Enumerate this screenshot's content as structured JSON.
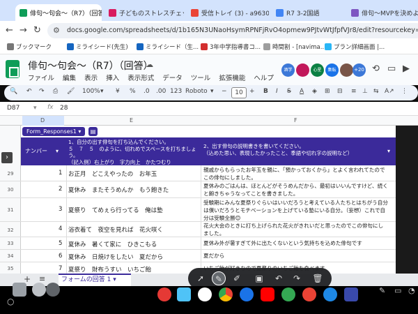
{
  "tabs": [
    {
      "label": "俳句〜句会〜（R7）（回答",
      "active": true
    },
    {
      "label": "子どものストレスチェック"
    },
    {
      "label": "受信トレイ (3) - a963091"
    },
    {
      "label": "R7 3-2国語"
    },
    {
      "label": "俳句〜MVPを決めよう"
    }
  ],
  "address": {
    "url": "docs.google.com/spreadsheets/d/1b165N3UNaoHsymRPNFjRvO4opmew9PJtvWtJfpfVJr8/edit?resourcekey=&gid=130295"
  },
  "bookmarks": [
    {
      "label": "ブックマーク"
    },
    {
      "label": "ミライシード(先生)"
    },
    {
      "label": "ミライシード（生..."
    },
    {
      "label": "3年中学指導書コ..."
    },
    {
      "label": "時間割 - [navima..."
    },
    {
      "label": "プラン詳細画面 |..."
    }
  ],
  "doc": {
    "title": "俳句〜句会〜（R7）（回答）",
    "menus": [
      "ファイル",
      "編集",
      "表示",
      "挿入",
      "表示形式",
      "データ",
      "ツール",
      "拡張機能",
      "ヘルプ"
    ],
    "avatars": [
      {
        "label": "酒学",
        "color": "#3c78d8"
      },
      {
        "label": "",
        "color": "#c2185b"
      },
      {
        "label": "心星",
        "color": "#0b8043"
      },
      {
        "label": "集転",
        "color": "#1a73e8"
      },
      {
        "label": "",
        "color": "#795548"
      }
    ],
    "extra_count": "+20"
  },
  "format_toolbar": {
    "zoom": "100%",
    "currency": "¥",
    "percent": "%",
    "decimal_less": ".0",
    "decimal_more": ".00",
    "number_format": "123",
    "font": "Roboto",
    "font_size": "10"
  },
  "formula_bar": {
    "cell_ref": "D87",
    "fx": "fx",
    "value": "28"
  },
  "columns": {
    "d": "D",
    "e": "E",
    "f": "F"
  },
  "table": {
    "name": "Form_Responses1",
    "header_number": "ナンバー",
    "header_haiku": "1、自分の出す俳句を打ち込んでください。\n５　７　５　のように、切れめでスペースを打ちましょう。\n（記入例）右上がり　字力向上　かたつむり",
    "header_desc": "2、出す俳句の説明書きを書いてください。\n（込めた思い、表現したかったこと、季語や切れ字の説明など）",
    "rows": [
      {
        "row": "29",
        "num": "1",
        "haiku": "お正月　どこえやったの　お年玉",
        "desc": "親戚からもらったお年玉を親に、「預かっておくから」とよく言われてたのでこの俳句にしました。"
      },
      {
        "row": "30",
        "num": "2",
        "haiku": "夏休み　またそうめんか　もう飽きた",
        "desc": "夏休みのごはんは、ほとんどがそうめんだから、最初はいいんですけど、続くと飽きちゃうなってことを書きました。"
      },
      {
        "row": "31",
        "num": "3",
        "haiku": "夏祭り　てめぇら行ってる　俺は塾",
        "desc": "受験期にみんな夏祭りぐらいはいいだろうと考えている人たちとはちがう自分は僕いだろうとモチベーションを上げている塾にいる自分。（妄想）これで自分は受験全勝😊"
      },
      {
        "row": "32",
        "num": "4",
        "haiku": "浴衣着て　夜空を見れば　花火咲く",
        "desc": "花火大会のときに打ち上げられた花火がきれいだと思ったのでこの俳句にしました。"
      },
      {
        "row": "33",
        "num": "5",
        "haiku": "夏休み　暑くて家に　ひきこもる",
        "desc": "夏休み外が暑すぎて外に出たくないという気持ちを込めた俳句です"
      },
      {
        "row": "34",
        "num": "6",
        "haiku": "夏休み　日焼けをしたい　夏だから",
        "desc": "夏だから"
      },
      {
        "row": "35",
        "num": "7",
        "haiku": "夏祭り　財布うすい　いちご飴",
        "desc": "いちご飴が好きなので夏祭りのいちご飴を食べます"
      }
    ]
  },
  "sheet_tab": {
    "label": "フォームの回答 1"
  }
}
